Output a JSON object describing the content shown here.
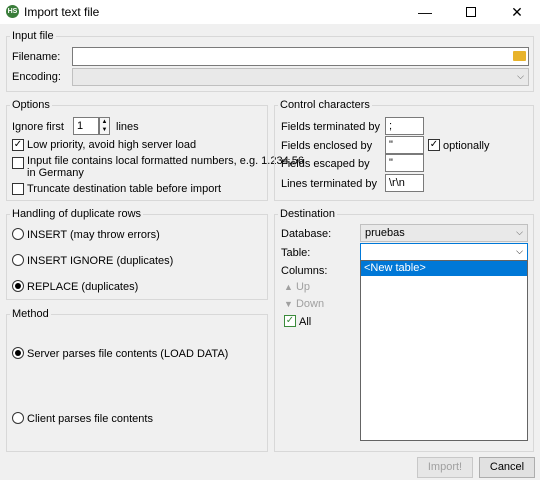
{
  "window": {
    "title": "Import text file",
    "icon": "HS"
  },
  "input_file": {
    "group_title": "Input file",
    "filename_label": "Filename:",
    "filename_value": "",
    "encoding_label": "Encoding:",
    "encoding_value": ""
  },
  "options": {
    "group_title": "Options",
    "ignore_first_label": "Ignore first",
    "ignore_first_value": "1",
    "lines_label": "lines",
    "low_priority_label": "Low priority, avoid high server load",
    "low_priority_checked": true,
    "local_numbers_label_1": "Input file contains local formatted numbers, e.g. 1.234,56",
    "local_numbers_label_2": "in Germany",
    "local_numbers_checked": false,
    "truncate_label": "Truncate destination table before import",
    "truncate_checked": false
  },
  "control_chars": {
    "group_title": "Control characters",
    "terminated_label": "Fields terminated by",
    "terminated_value": ";",
    "enclosed_label": "Fields enclosed by",
    "enclosed_value": "\"",
    "optionally_label": "optionally",
    "optionally_checked": true,
    "escaped_label": "Fields escaped by",
    "escaped_value": "\"",
    "lines_terminated_label": "Lines terminated by",
    "lines_terminated_value": "\\r\\n"
  },
  "duplicates": {
    "group_title": "Handling of duplicate rows",
    "options": [
      "INSERT (may throw errors)",
      "INSERT IGNORE (duplicates)",
      "REPLACE (duplicates)"
    ],
    "selected": "REPLACE (duplicates)"
  },
  "method": {
    "group_title": "Method",
    "options": [
      "Server parses file contents (LOAD DATA)",
      "Client parses file contents"
    ],
    "selected": "Server parses file contents (LOAD DATA)"
  },
  "destination": {
    "group_title": "Destination",
    "database_label": "Database:",
    "database_value": "pruebas",
    "table_label": "Table:",
    "table_value": "",
    "table_dropdown_options": [
      "<New table>"
    ],
    "columns_label": "Columns:",
    "up_label": "Up",
    "down_label": "Down",
    "all_label": "All",
    "all_checked": true
  },
  "footer": {
    "import_label": "Import!",
    "cancel_label": "Cancel"
  },
  "colors": {
    "accent": "#0078d7",
    "group_border": "#d8d8d8",
    "folder": "#e8b32a"
  }
}
